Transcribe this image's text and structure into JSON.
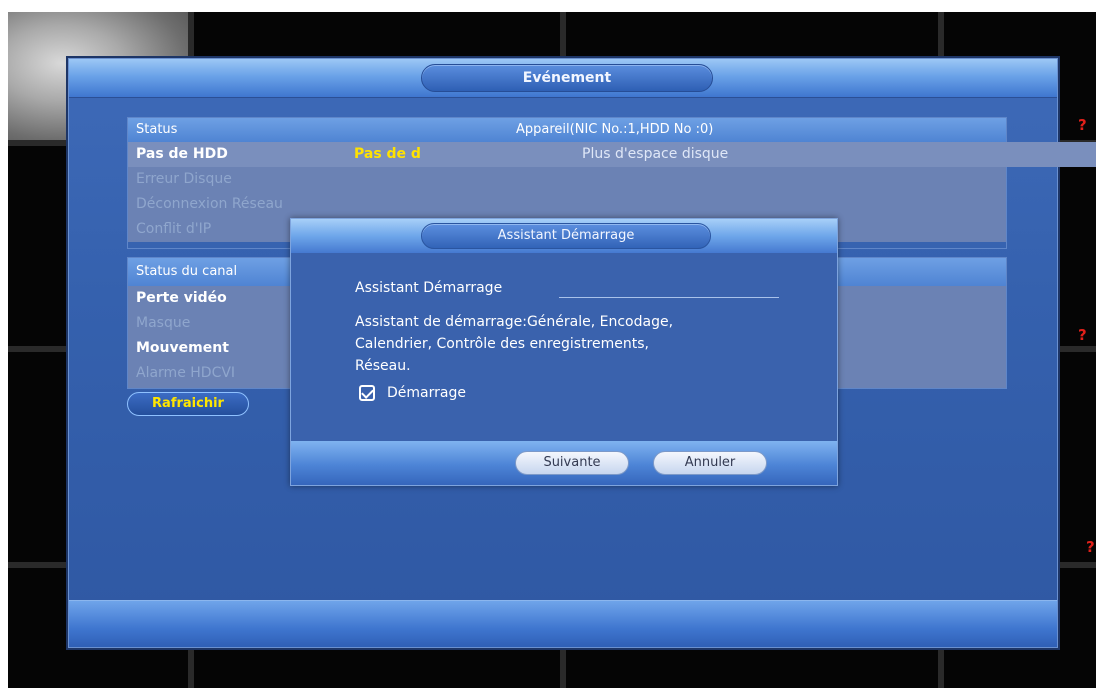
{
  "window": {
    "title": "Evénement"
  },
  "status_table": {
    "header_left": "Status",
    "header_right": "Appareil(NIC No.:1,HDD No :0)",
    "rows": [
      {
        "label": "Pas de HDD",
        "value": "Pas de d",
        "detail": "Plus d'espace disque"
      },
      {
        "label": "Erreur Disque"
      },
      {
        "label": "Déconnexion Réseau"
      },
      {
        "label": "Conflit d'IP"
      }
    ]
  },
  "channel_table": {
    "header": "Status du canal",
    "rows": [
      "Perte vidéo",
      "Masque",
      "Mouvement",
      "Alarme HDCVI"
    ]
  },
  "refresh_label": "Rafraichir",
  "wizard": {
    "title": "Assistant Démarrage",
    "heading": "Assistant Démarrage",
    "description_line1": "Assistant de démarrage:Générale, Encodage,",
    "description_line2": "Calendrier, Contrôle des enregistrements,",
    "description_line3": "Réseau.",
    "checkbox_label": "Démarrage",
    "checkbox_checked": true,
    "next_label": "Suivante",
    "cancel_label": "Annuler"
  },
  "background": {
    "marker": "?"
  }
}
